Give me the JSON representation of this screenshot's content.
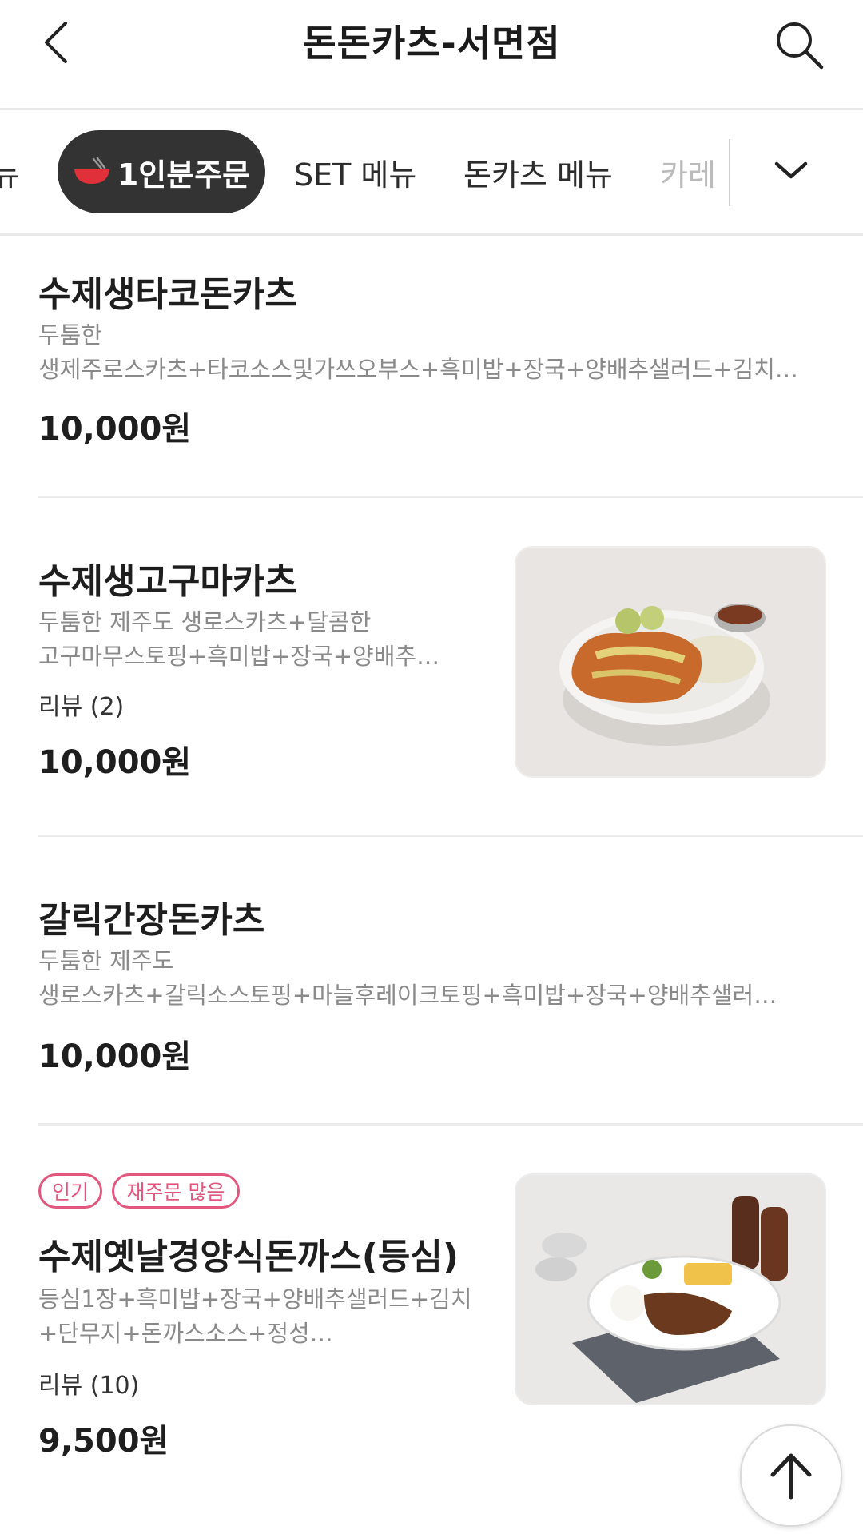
{
  "header": {
    "title": "돈돈카츠-서면점",
    "back_icon": "chevron-left-icon",
    "search_icon": "search-icon"
  },
  "tabs": [
    {
      "label": "뉴",
      "state": "partial"
    },
    {
      "label": "1인분주문",
      "state": "active",
      "icon": "bowl-icon"
    },
    {
      "label": "SET 메뉴",
      "state": "normal"
    },
    {
      "label": "돈카츠 메뉴",
      "state": "normal"
    },
    {
      "label": "카레",
      "state": "faded"
    }
  ],
  "tabs_expand_icon": "chevron-down-icon",
  "items": [
    {
      "name": "수제생타코돈카츠",
      "desc_lines": [
        "두툼한",
        "생제주로스카츠+타코소스및가쓰오부스+흑미밥+장국+양배추샐러드+김치…"
      ],
      "review": "",
      "price": "10,000원",
      "badges": []
    },
    {
      "name": "수제생고구마카츠",
      "desc_lines": [
        "두툼한 제주도 생로스카츠+달콤한",
        "고구마무스토핑+흑미밥+장국+양배추…"
      ],
      "review": "리뷰 (2)",
      "price": "10,000원",
      "badges": [],
      "image": "sweet-potato-katsu-photo"
    },
    {
      "name": "갈릭간장돈카츠",
      "desc_lines": [
        "두툼한 제주도",
        "생로스카츠+갈릭소스토핑+마늘후레이크토핑+흑미밥+장국+양배추샐러…"
      ],
      "review": "",
      "price": "10,000원",
      "badges": []
    },
    {
      "name": "수제옛날경양식돈까스(등심)",
      "desc_lines": [
        "등심1장+흑미밥+장국+양배추샐러드+김치",
        "+단무지+돈까스소스+정성…"
      ],
      "review": "리뷰 (10)",
      "price": "9,500원",
      "badges": [
        "인기",
        "재주문 많음"
      ],
      "image": "retro-tonkatsu-photo"
    }
  ],
  "scroll_top_icon": "arrow-up-icon",
  "colors": {
    "active_tab_bg": "#333333",
    "badge": "#e2577e",
    "divider": "#ececec"
  }
}
